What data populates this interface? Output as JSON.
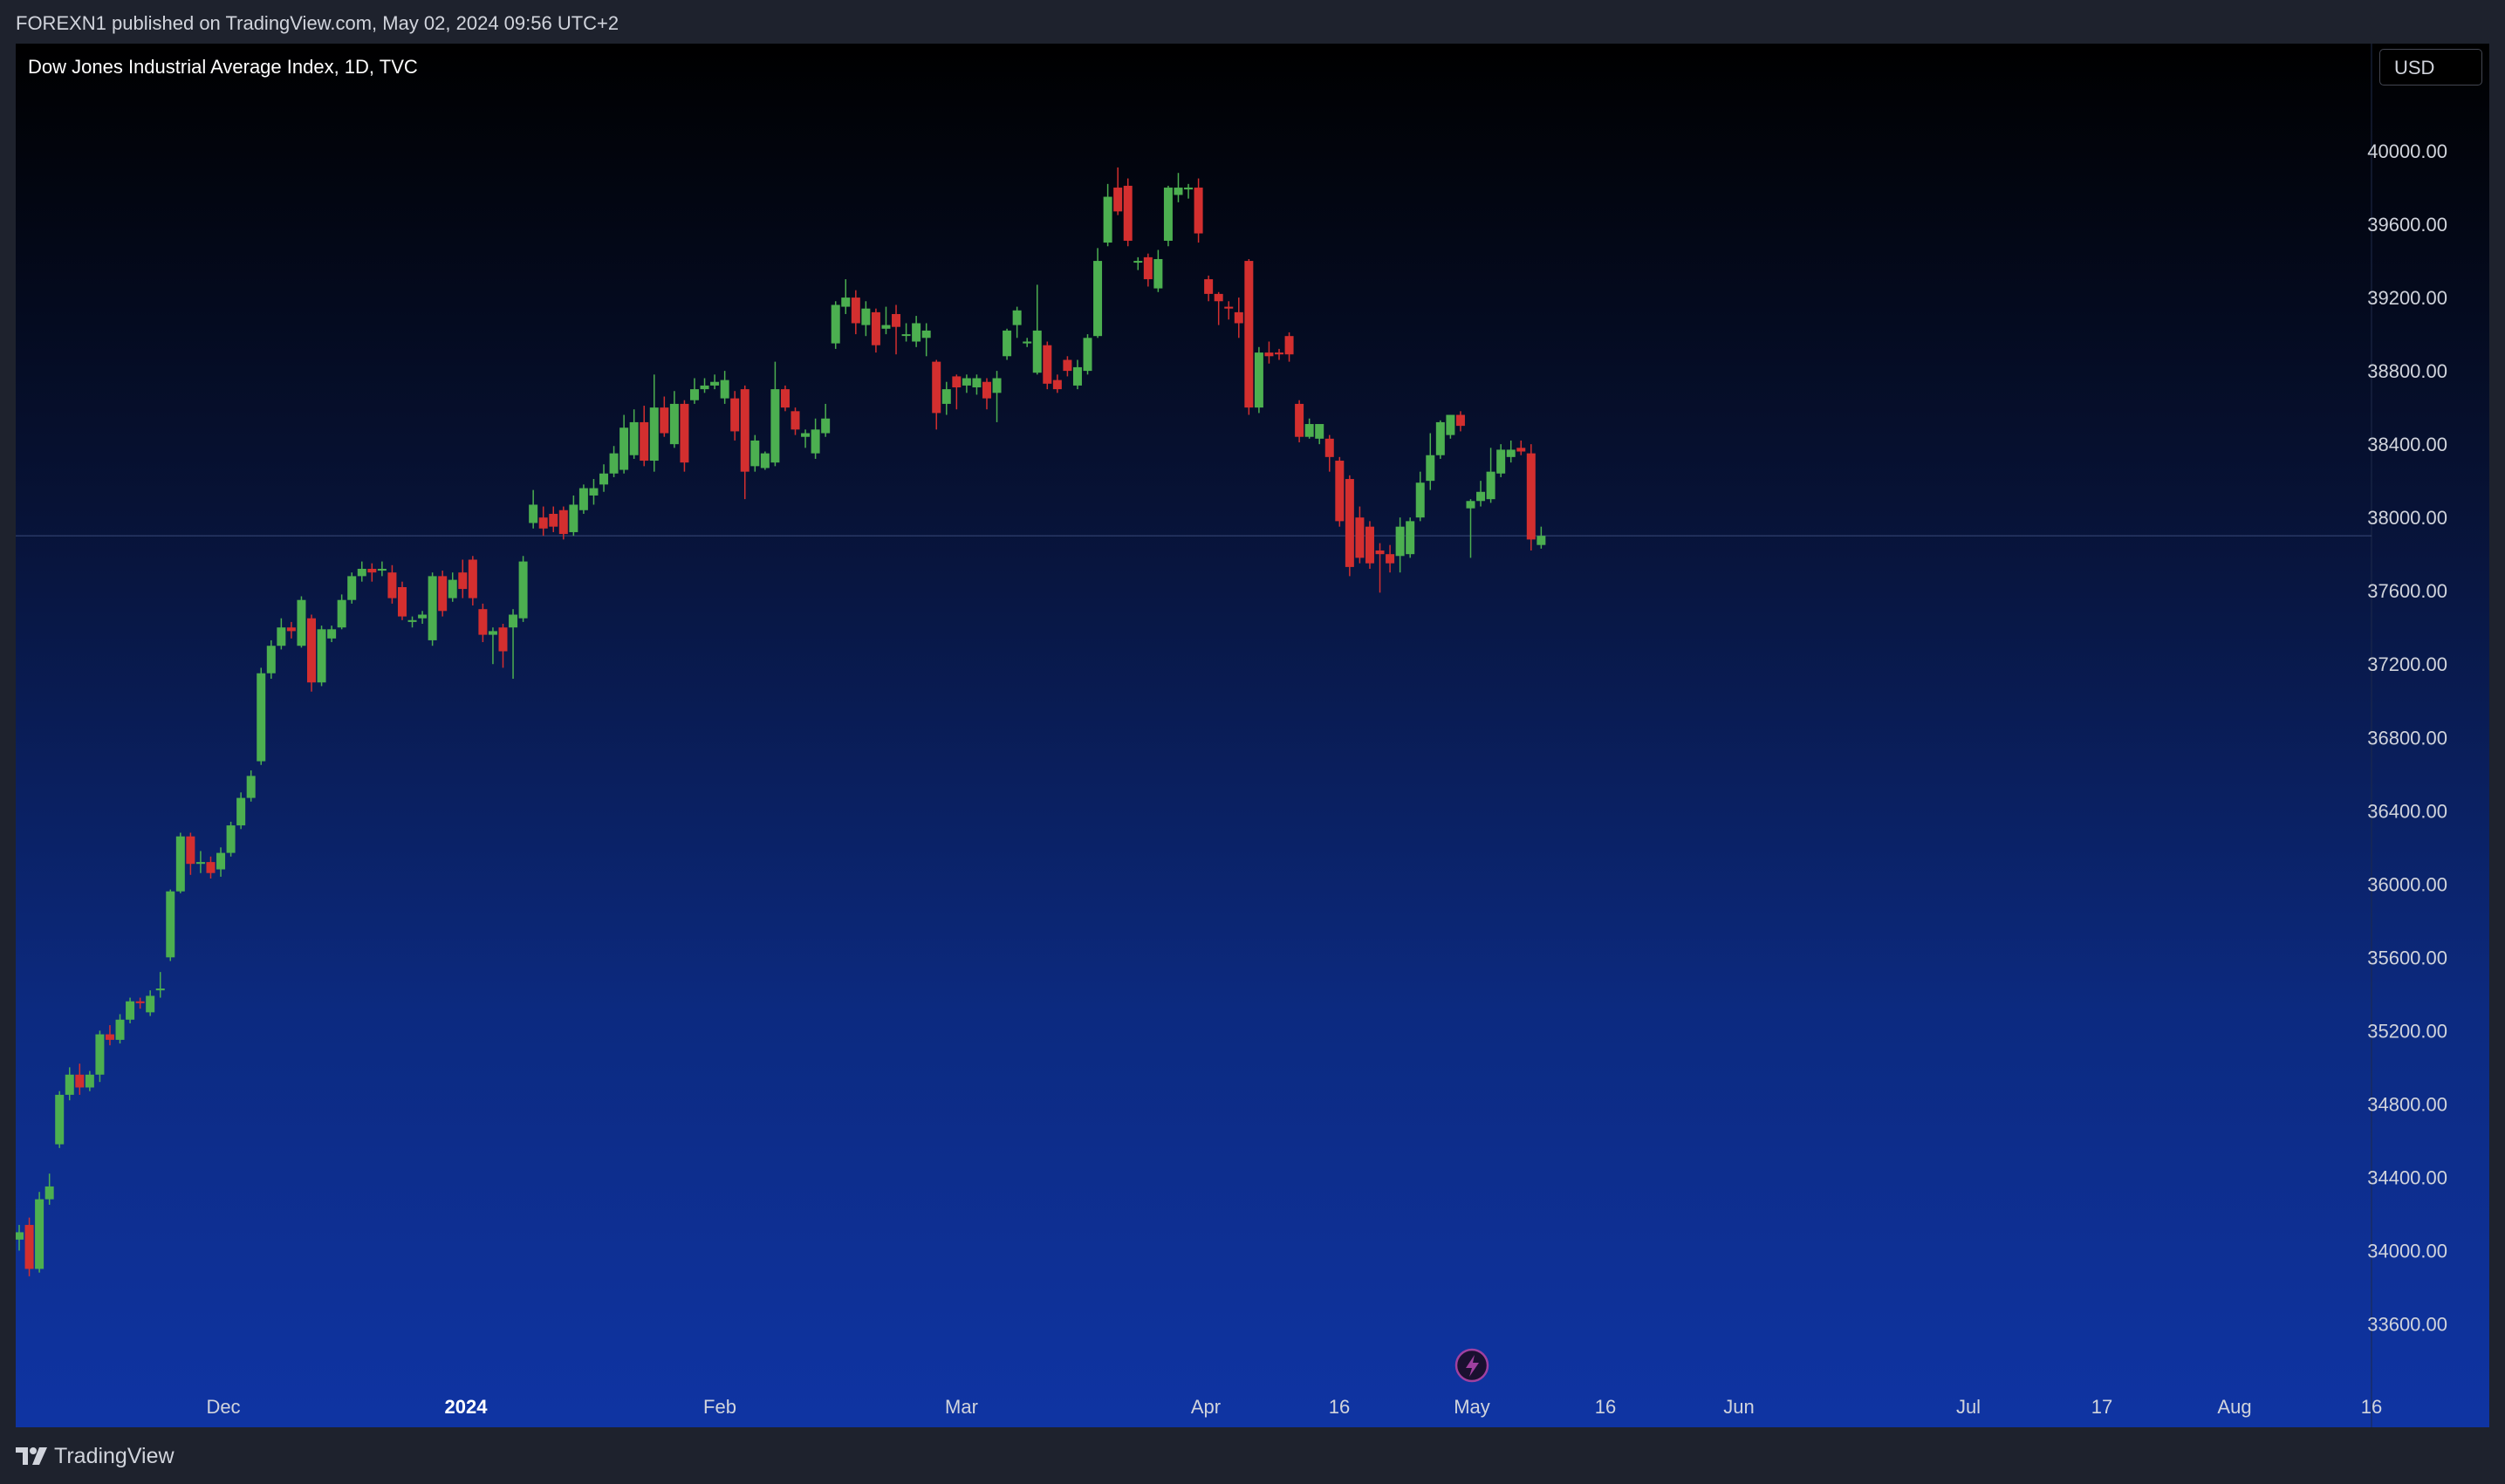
{
  "header": {
    "published_text": "FOREXN1 published on TradingView.com, May 02, 2024 09:56 UTC+2"
  },
  "legend": {
    "title": "Dow Jones Industrial Average Index, 1D, TVC"
  },
  "currency_button": {
    "label": "USD"
  },
  "footer": {
    "logo_text": "TradingView",
    "logo_icon": "tradingview-logo-icon"
  },
  "colors": {
    "up": "#4caf50",
    "down": "#d32f2f",
    "gradient_top": "#000000",
    "gradient_bottom": "#0f34a3",
    "price_line": "#3a4a7a",
    "events_marker": "#a040a0"
  },
  "events_marker": {
    "icon": "lightning-icon"
  },
  "chart_data": {
    "type": "candlestick",
    "symbol": "Dow Jones Industrial Average Index",
    "interval": "1D",
    "source": "TVC",
    "ylim": [
      33350,
      40300
    ],
    "y_ticks": [
      "40000.00",
      "39600.00",
      "39200.00",
      "38800.00",
      "38400.00",
      "38000.00",
      "37600.00",
      "37200.00",
      "36800.00",
      "36400.00",
      "36000.00",
      "35600.00",
      "35200.00",
      "34800.00",
      "34400.00",
      "34000.00",
      "33600.00"
    ],
    "x_ticks": [
      {
        "label": "Dec",
        "bold": false
      },
      {
        "label": "2024",
        "bold": true
      },
      {
        "label": "Feb",
        "bold": false
      },
      {
        "label": "Mar",
        "bold": false
      },
      {
        "label": "Apr",
        "bold": false
      },
      {
        "label": "16",
        "bold": false
      },
      {
        "label": "May",
        "bold": false
      },
      {
        "label": "16",
        "bold": false
      },
      {
        "label": "Jun",
        "bold": false
      },
      {
        "label": "Jul",
        "bold": false
      },
      {
        "label": "17",
        "bold": false
      },
      {
        "label": "Aug",
        "bold": false
      },
      {
        "label": "16",
        "bold": false
      }
    ],
    "last_price": 37900,
    "candles": [
      [
        34060,
        34100,
        34000,
        34140
      ],
      [
        34140,
        33900,
        33860,
        34180
      ],
      [
        33900,
        34280,
        33880,
        34320
      ],
      [
        34280,
        34350,
        34250,
        34420
      ],
      [
        34580,
        34850,
        34560,
        34870
      ],
      [
        34850,
        34960,
        34820,
        35000
      ],
      [
        34960,
        34890,
        34850,
        35020
      ],
      [
        34890,
        34960,
        34870,
        34980
      ],
      [
        34960,
        35180,
        34920,
        35200
      ],
      [
        35180,
        35150,
        35120,
        35230
      ],
      [
        35150,
        35260,
        35130,
        35290
      ],
      [
        35260,
        35360,
        35240,
        35380
      ],
      [
        35360,
        35350,
        35320,
        35380
      ],
      [
        35300,
        35390,
        35280,
        35420
      ],
      [
        35420,
        35430,
        35380,
        35520
      ],
      [
        35600,
        35960,
        35580,
        35970
      ],
      [
        35960,
        36260,
        35950,
        36280
      ],
      [
        36260,
        36110,
        36050,
        36280
      ],
      [
        36110,
        36120,
        36060,
        36180
      ],
      [
        36120,
        36060,
        36030,
        36150
      ],
      [
        36080,
        36170,
        36040,
        36200
      ],
      [
        36170,
        36320,
        36150,
        36340
      ],
      [
        36320,
        36470,
        36300,
        36500
      ],
      [
        36470,
        36590,
        36450,
        36620
      ],
      [
        36670,
        37150,
        36650,
        37180
      ],
      [
        37150,
        37300,
        37120,
        37330
      ],
      [
        37300,
        37400,
        37280,
        37450
      ],
      [
        37400,
        37380,
        37340,
        37430
      ],
      [
        37300,
        37550,
        37290,
        37570
      ],
      [
        37450,
        37100,
        37050,
        37470
      ],
      [
        37100,
        37390,
        37080,
        37410
      ],
      [
        37340,
        37390,
        37320,
        37410
      ],
      [
        37400,
        37550,
        37390,
        37580
      ],
      [
        37550,
        37680,
        37530,
        37700
      ],
      [
        37680,
        37720,
        37650,
        37760
      ],
      [
        37720,
        37700,
        37650,
        37750
      ],
      [
        37710,
        37720,
        37680,
        37760
      ],
      [
        37700,
        37560,
        37530,
        37740
      ],
      [
        37620,
        37460,
        37440,
        37650
      ],
      [
        37430,
        37440,
        37400,
        37460
      ],
      [
        37450,
        37470,
        37420,
        37490
      ],
      [
        37330,
        37680,
        37300,
        37700
      ],
      [
        37680,
        37490,
        37460,
        37710
      ],
      [
        37560,
        37660,
        37540,
        37700
      ],
      [
        37700,
        37610,
        37560,
        37770
      ],
      [
        37770,
        37560,
        37520,
        37790
      ],
      [
        37500,
        37360,
        37320,
        37530
      ],
      [
        37360,
        37380,
        37200,
        37400
      ],
      [
        37400,
        37270,
        37180,
        37420
      ],
      [
        37400,
        37470,
        37120,
        37500
      ],
      [
        37450,
        37760,
        37430,
        37790
      ],
      [
        37970,
        38070,
        37940,
        38150
      ],
      [
        38000,
        37940,
        37900,
        38060
      ],
      [
        38020,
        37950,
        37920,
        38060
      ],
      [
        38040,
        37910,
        37880,
        38060
      ],
      [
        37920,
        38070,
        37900,
        38120
      ],
      [
        38040,
        38160,
        38020,
        38180
      ],
      [
        38120,
        38160,
        38070,
        38210
      ],
      [
        38180,
        38240,
        38140,
        38290
      ],
      [
        38240,
        38350,
        38220,
        38390
      ],
      [
        38260,
        38490,
        38240,
        38560
      ],
      [
        38340,
        38520,
        38320,
        38590
      ],
      [
        38520,
        38310,
        38280,
        38610
      ],
      [
        38310,
        38600,
        38250,
        38780
      ],
      [
        38600,
        38460,
        38440,
        38660
      ],
      [
        38400,
        38620,
        38380,
        38690
      ],
      [
        38620,
        38300,
        38250,
        38640
      ],
      [
        38640,
        38700,
        38620,
        38760
      ],
      [
        38700,
        38720,
        38680,
        38760
      ],
      [
        38720,
        38740,
        38700,
        38780
      ],
      [
        38650,
        38750,
        38620,
        38800
      ],
      [
        38650,
        38470,
        38420,
        38690
      ],
      [
        38700,
        38250,
        38100,
        38720
      ],
      [
        38280,
        38420,
        38250,
        38450
      ],
      [
        38270,
        38350,
        38260,
        38360
      ],
      [
        38300,
        38700,
        38280,
        38850
      ],
      [
        38700,
        38600,
        38580,
        38720
      ],
      [
        38580,
        38480,
        38450,
        38600
      ],
      [
        38440,
        38460,
        38380,
        38480
      ],
      [
        38350,
        38480,
        38320,
        38540
      ],
      [
        38460,
        38540,
        38440,
        38620
      ],
      [
        38950,
        39160,
        38920,
        39180
      ],
      [
        39150,
        39200,
        39110,
        39300
      ],
      [
        39200,
        39060,
        39000,
        39240
      ],
      [
        39050,
        39140,
        38990,
        39180
      ],
      [
        39120,
        38940,
        38900,
        39140
      ],
      [
        39030,
        39050,
        39000,
        39150
      ],
      [
        39110,
        39040,
        38890,
        39160
      ],
      [
        39000,
        39000,
        38960,
        39060
      ],
      [
        38960,
        39060,
        38930,
        39100
      ],
      [
        38980,
        39020,
        38880,
        39060
      ],
      [
        38850,
        38570,
        38480,
        38860
      ],
      [
        38620,
        38700,
        38560,
        38740
      ],
      [
        38770,
        38710,
        38590,
        38780
      ],
      [
        38720,
        38760,
        38680,
        38780
      ],
      [
        38710,
        38760,
        38670,
        38780
      ],
      [
        38740,
        38650,
        38590,
        38760
      ],
      [
        38680,
        38760,
        38520,
        38800
      ],
      [
        38880,
        39020,
        38860,
        39030
      ],
      [
        39050,
        39130,
        38980,
        39150
      ],
      [
        38950,
        38960,
        38930,
        38980
      ],
      [
        38790,
        39020,
        38780,
        39270
      ],
      [
        38940,
        38730,
        38700,
        38960
      ],
      [
        38750,
        38700,
        38680,
        38780
      ],
      [
        38860,
        38800,
        38770,
        38880
      ],
      [
        38720,
        38820,
        38700,
        38860
      ],
      [
        38800,
        38980,
        38780,
        39000
      ],
      [
        38990,
        39400,
        38980,
        39470
      ],
      [
        39500,
        39750,
        39480,
        39820
      ],
      [
        39800,
        39670,
        39650,
        39910
      ],
      [
        39810,
        39510,
        39480,
        39850
      ],
      [
        39400,
        39400,
        39350,
        39420
      ],
      [
        39420,
        39300,
        39260,
        39440
      ],
      [
        39250,
        39410,
        39230,
        39460
      ],
      [
        39510,
        39800,
        39480,
        39810
      ],
      [
        39760,
        39800,
        39720,
        39880
      ],
      [
        39790,
        39800,
        39740,
        39820
      ],
      [
        39800,
        39550,
        39500,
        39850
      ],
      [
        39300,
        39220,
        39180,
        39320
      ],
      [
        39220,
        39180,
        39050,
        39230
      ],
      [
        39150,
        39140,
        39080,
        39180
      ],
      [
        39120,
        39060,
        38980,
        39200
      ],
      [
        39400,
        38600,
        38560,
        39410
      ],
      [
        38600,
        38900,
        38570,
        38930
      ],
      [
        38900,
        38880,
        38840,
        38960
      ],
      [
        38900,
        38890,
        38860,
        38920
      ],
      [
        38990,
        38890,
        38850,
        39010
      ],
      [
        38620,
        38440,
        38410,
        38640
      ],
      [
        38440,
        38510,
        38430,
        38540
      ],
      [
        38430,
        38510,
        38400,
        38480
      ],
      [
        38430,
        38330,
        38250,
        38450
      ],
      [
        38310,
        37980,
        37950,
        38330
      ],
      [
        38210,
        37730,
        37680,
        38230
      ],
      [
        38000,
        37780,
        37750,
        38060
      ],
      [
        37950,
        37750,
        37720,
        37980
      ],
      [
        37820,
        37800,
        37590,
        37860
      ],
      [
        37800,
        37750,
        37700,
        37850
      ],
      [
        37790,
        37950,
        37700,
        38000
      ],
      [
        37800,
        37980,
        37780,
        38000
      ],
      [
        38000,
        38190,
        37980,
        38250
      ],
      [
        38200,
        38340,
        38150,
        38460
      ],
      [
        38340,
        38520,
        38320,
        38530
      ],
      [
        38450,
        38560,
        38430,
        38560
      ],
      [
        38560,
        38500,
        38470,
        38580
      ],
      [
        38050,
        38090,
        37780,
        38100
      ],
      [
        38090,
        38140,
        38060,
        38200
      ],
      [
        38100,
        38250,
        38080,
        38380
      ],
      [
        38240,
        38370,
        38220,
        38400
      ],
      [
        38330,
        38370,
        38300,
        38420
      ],
      [
        38380,
        38360,
        38340,
        38420
      ],
      [
        38350,
        37880,
        37820,
        38400
      ],
      [
        37850,
        37900,
        37830,
        37950
      ]
    ],
    "candle_index_map": "sequential trading days from mid-Nov 2023 to May 01, 2024"
  }
}
